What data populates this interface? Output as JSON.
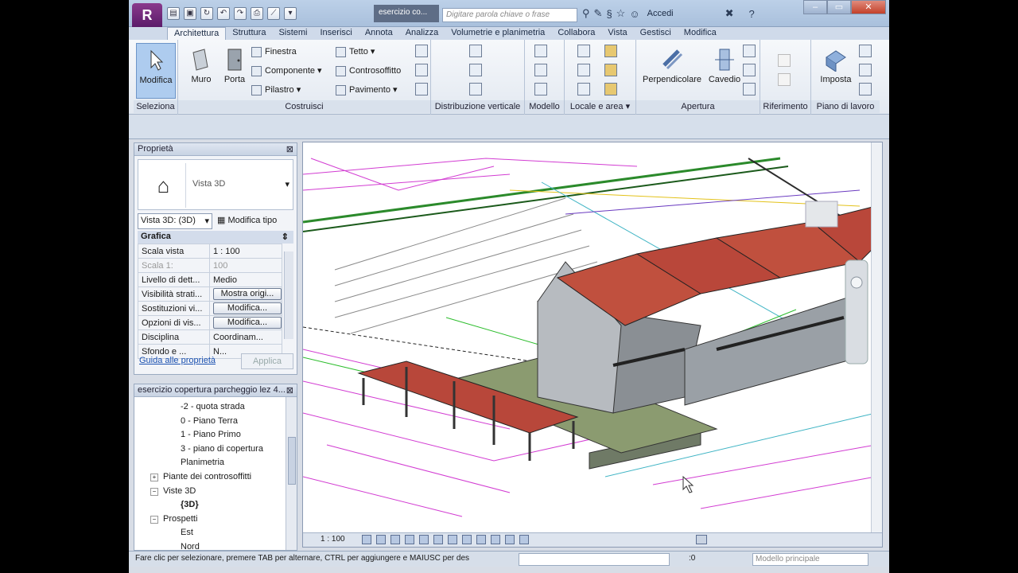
{
  "app": {
    "logo": "R",
    "doc_title": "esercizio co...",
    "search_placeholder": "Digitare parola chiave o frase",
    "sign_in": "Accedi",
    "help": "?"
  },
  "qat_icons": [
    "open-icon",
    "save-icon",
    "sync-icon",
    "undo-icon",
    "redo-icon",
    "print-icon",
    "measure-icon",
    "dropdown-icon"
  ],
  "window_controls": {
    "minimize": "–",
    "maximize": "▭",
    "close": "✕"
  },
  "tabs": [
    "Architettura",
    "Struttura",
    "Sistemi",
    "Inserisci",
    "Annota",
    "Analizza",
    "Volumetrie e planimetria",
    "Collabora",
    "Vista",
    "Gestisci",
    "Modifica"
  ],
  "active_tab": "Architettura",
  "ribbon": {
    "select_panel": {
      "label": "Seleziona",
      "button": "Modifica"
    },
    "build_panel": {
      "label": "Costruisci",
      "wall": "Muro",
      "door": "Porta",
      "window": "Finestra",
      "component": "Componente",
      "column": "Pilastro",
      "roof": "Tetto",
      "ceiling": "Controsoffitto",
      "floor": "Pavimento"
    },
    "circulation_panel": {
      "label": "Distribuzione verticale"
    },
    "model_panel": {
      "label": "Modello"
    },
    "room_panel": {
      "label": "Locale e area"
    },
    "opening_panel": {
      "label": "Apertura",
      "perpendicular": "Perpendicolare",
      "shaft": "Cavedio"
    },
    "datum_panel": {
      "label": "Riferimento"
    },
    "workplane_panel": {
      "label": "Piano di lavoro",
      "set": "Imposta"
    }
  },
  "properties": {
    "title": "Proprietà",
    "type_name": "Vista 3D",
    "selector": "Vista 3D: (3D)",
    "edit_type": "Modifica tipo",
    "group": "Grafica",
    "rows": [
      {
        "k": "Scala vista",
        "v": "1 : 100"
      },
      {
        "k": "Scala 1:",
        "v": "100"
      },
      {
        "k": "Livello di dett...",
        "v": "Medio"
      },
      {
        "k": "Visibilità strati...",
        "v": "Mostra origi..."
      },
      {
        "k": "Sostituzioni vi...",
        "v": "Modifica..."
      },
      {
        "k": "Opzioni di vis...",
        "v": "Modifica..."
      },
      {
        "k": "Disciplina",
        "v": "Coordinam..."
      },
      {
        "k": "Sfondo e ...",
        "v": "N..."
      }
    ],
    "help_link": "Guida alle proprietà",
    "apply": "Applica"
  },
  "browser": {
    "title": "esercizio copertura parcheggio lez 4...",
    "items": [
      {
        "label": "-2 - quota strada",
        "indent": 2,
        "toggle": ""
      },
      {
        "label": "0 - Piano Terra",
        "indent": 2,
        "toggle": ""
      },
      {
        "label": "1 - Piano Primo",
        "indent": 2,
        "toggle": ""
      },
      {
        "label": "3 - piano di copertura",
        "indent": 2,
        "toggle": ""
      },
      {
        "label": "Planimetria",
        "indent": 2,
        "toggle": ""
      },
      {
        "label": "Piante dei controsoffitti",
        "indent": 1,
        "toggle": "+"
      },
      {
        "label": "Viste 3D",
        "indent": 1,
        "toggle": "−"
      },
      {
        "label": "{3D}",
        "indent": 2,
        "toggle": "",
        "bold": true
      },
      {
        "label": "Prospetti",
        "indent": 1,
        "toggle": "−"
      },
      {
        "label": "Est",
        "indent": 2,
        "toggle": ""
      },
      {
        "label": "Nord",
        "indent": 2,
        "toggle": ""
      }
    ]
  },
  "view": {
    "scale": "1 : 100"
  },
  "status": {
    "message": "Fare clic per selezionare, premere TAB per alternare, CTRL per aggiungere e MAIUSC per des",
    "count": ":0",
    "model": "Modello principale"
  }
}
